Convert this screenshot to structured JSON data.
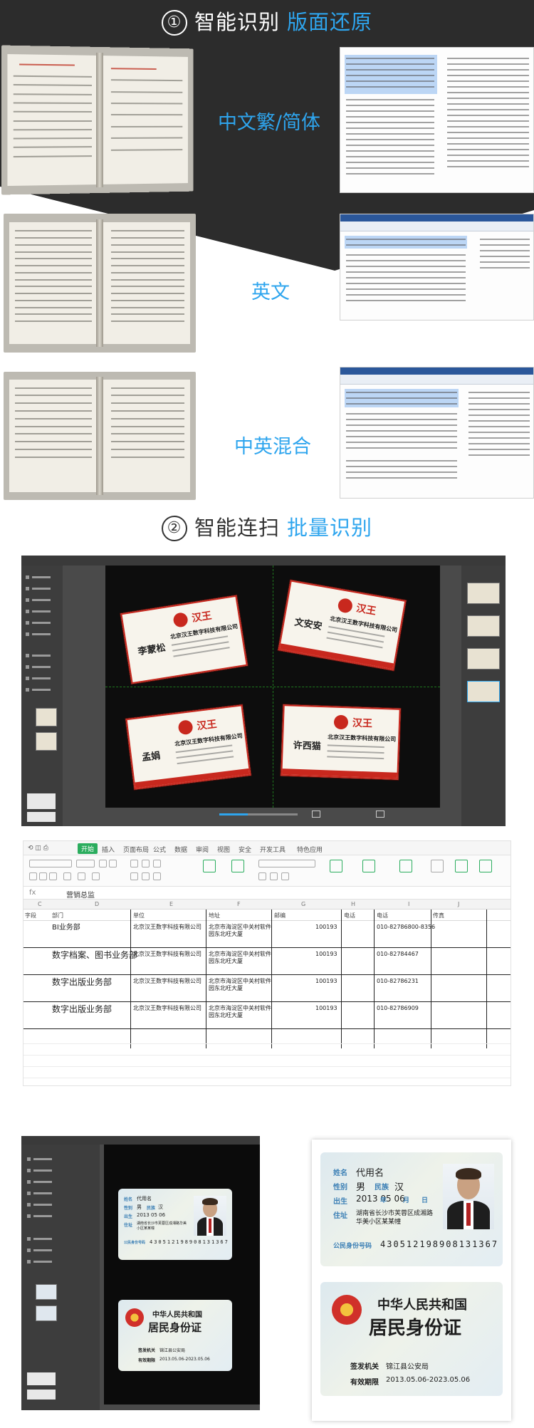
{
  "section1": {
    "number": "①",
    "title": "智能识别",
    "highlight": "版面还原"
  },
  "section2": {
    "number": "②",
    "title": "智能连扫",
    "highlight": "批量识别"
  },
  "languages": {
    "traditional_simplified": "中文繁/简体",
    "english": "英文",
    "mixed": "中英混合"
  },
  "scanner": {
    "cards": [
      {
        "name": "李蒙松",
        "company": "北京汉王数字科技有限公司"
      },
      {
        "name": "文安安",
        "company": "北京汉王数字科技有限公司"
      },
      {
        "name": "孟娟",
        "company": "北京汉王数字科技有限公司"
      },
      {
        "name": "许西猫",
        "company": "北京汉王数字科技有限公司"
      }
    ],
    "brand": "汉王"
  },
  "sheet": {
    "tabs": [
      "开始",
      "插入",
      "页面布局",
      "公式",
      "数据",
      "审阅",
      "视图",
      "安全",
      "开发工具",
      "特色应用"
    ],
    "formula": "营销总监",
    "columns": [
      "C",
      "D",
      "E",
      "F",
      "G",
      "H",
      "I",
      "J"
    ],
    "headers": [
      "字段",
      "部门",
      "单位",
      "地址",
      "邮编",
      "电话",
      "电话",
      "传真"
    ],
    "rows": [
      {
        "dept": "BI业务部",
        "unit": "北京汉王数字科技有限公司",
        "addr": "北京市海淀区中关村软件园东北旺大厦",
        "zip": "100193",
        "tel": "010-82786800-8356"
      },
      {
        "dept": "数字档案、图书业务部",
        "unit": "北京汉王数字科技有限公司",
        "addr": "北京市海淀区中关村软件园东北旺大厦",
        "zip": "100193",
        "tel": "010-82784467"
      },
      {
        "dept": "数字出版业务部",
        "unit": "北京汉王数字科技有限公司",
        "addr": "北京市海淀区中关村软件园东北旺大厦",
        "zip": "100193",
        "tel": "010-82786231"
      },
      {
        "dept": "数字出版业务部",
        "unit": "北京汉王数字科技有限公司",
        "addr": "北京市海淀区中关村软件园东北旺大厦",
        "zip": "100193",
        "tel": "010-82786909"
      }
    ]
  },
  "idcard": {
    "labels": {
      "name": "姓名",
      "gender": "性别",
      "ethnicity": "民族",
      "birth": "出生",
      "address": "住址",
      "id_number": "公民身份号码",
      "authority": "签发机关",
      "validity": "有效期限"
    },
    "name": "代用名",
    "gender": "男",
    "ethnicity": "汉",
    "birth": "2013  05  06",
    "year_label": "年",
    "month_label": "月",
    "day_label": "日",
    "address": "湖南省长沙市芙蓉区成湘路华美小区某某幢",
    "id_number": "430512198908131367",
    "country": "中华人民共和国",
    "card_name": "居民身份证",
    "authority": "锦江县公安局",
    "validity": "2013.05.06-2023.05.06"
  }
}
